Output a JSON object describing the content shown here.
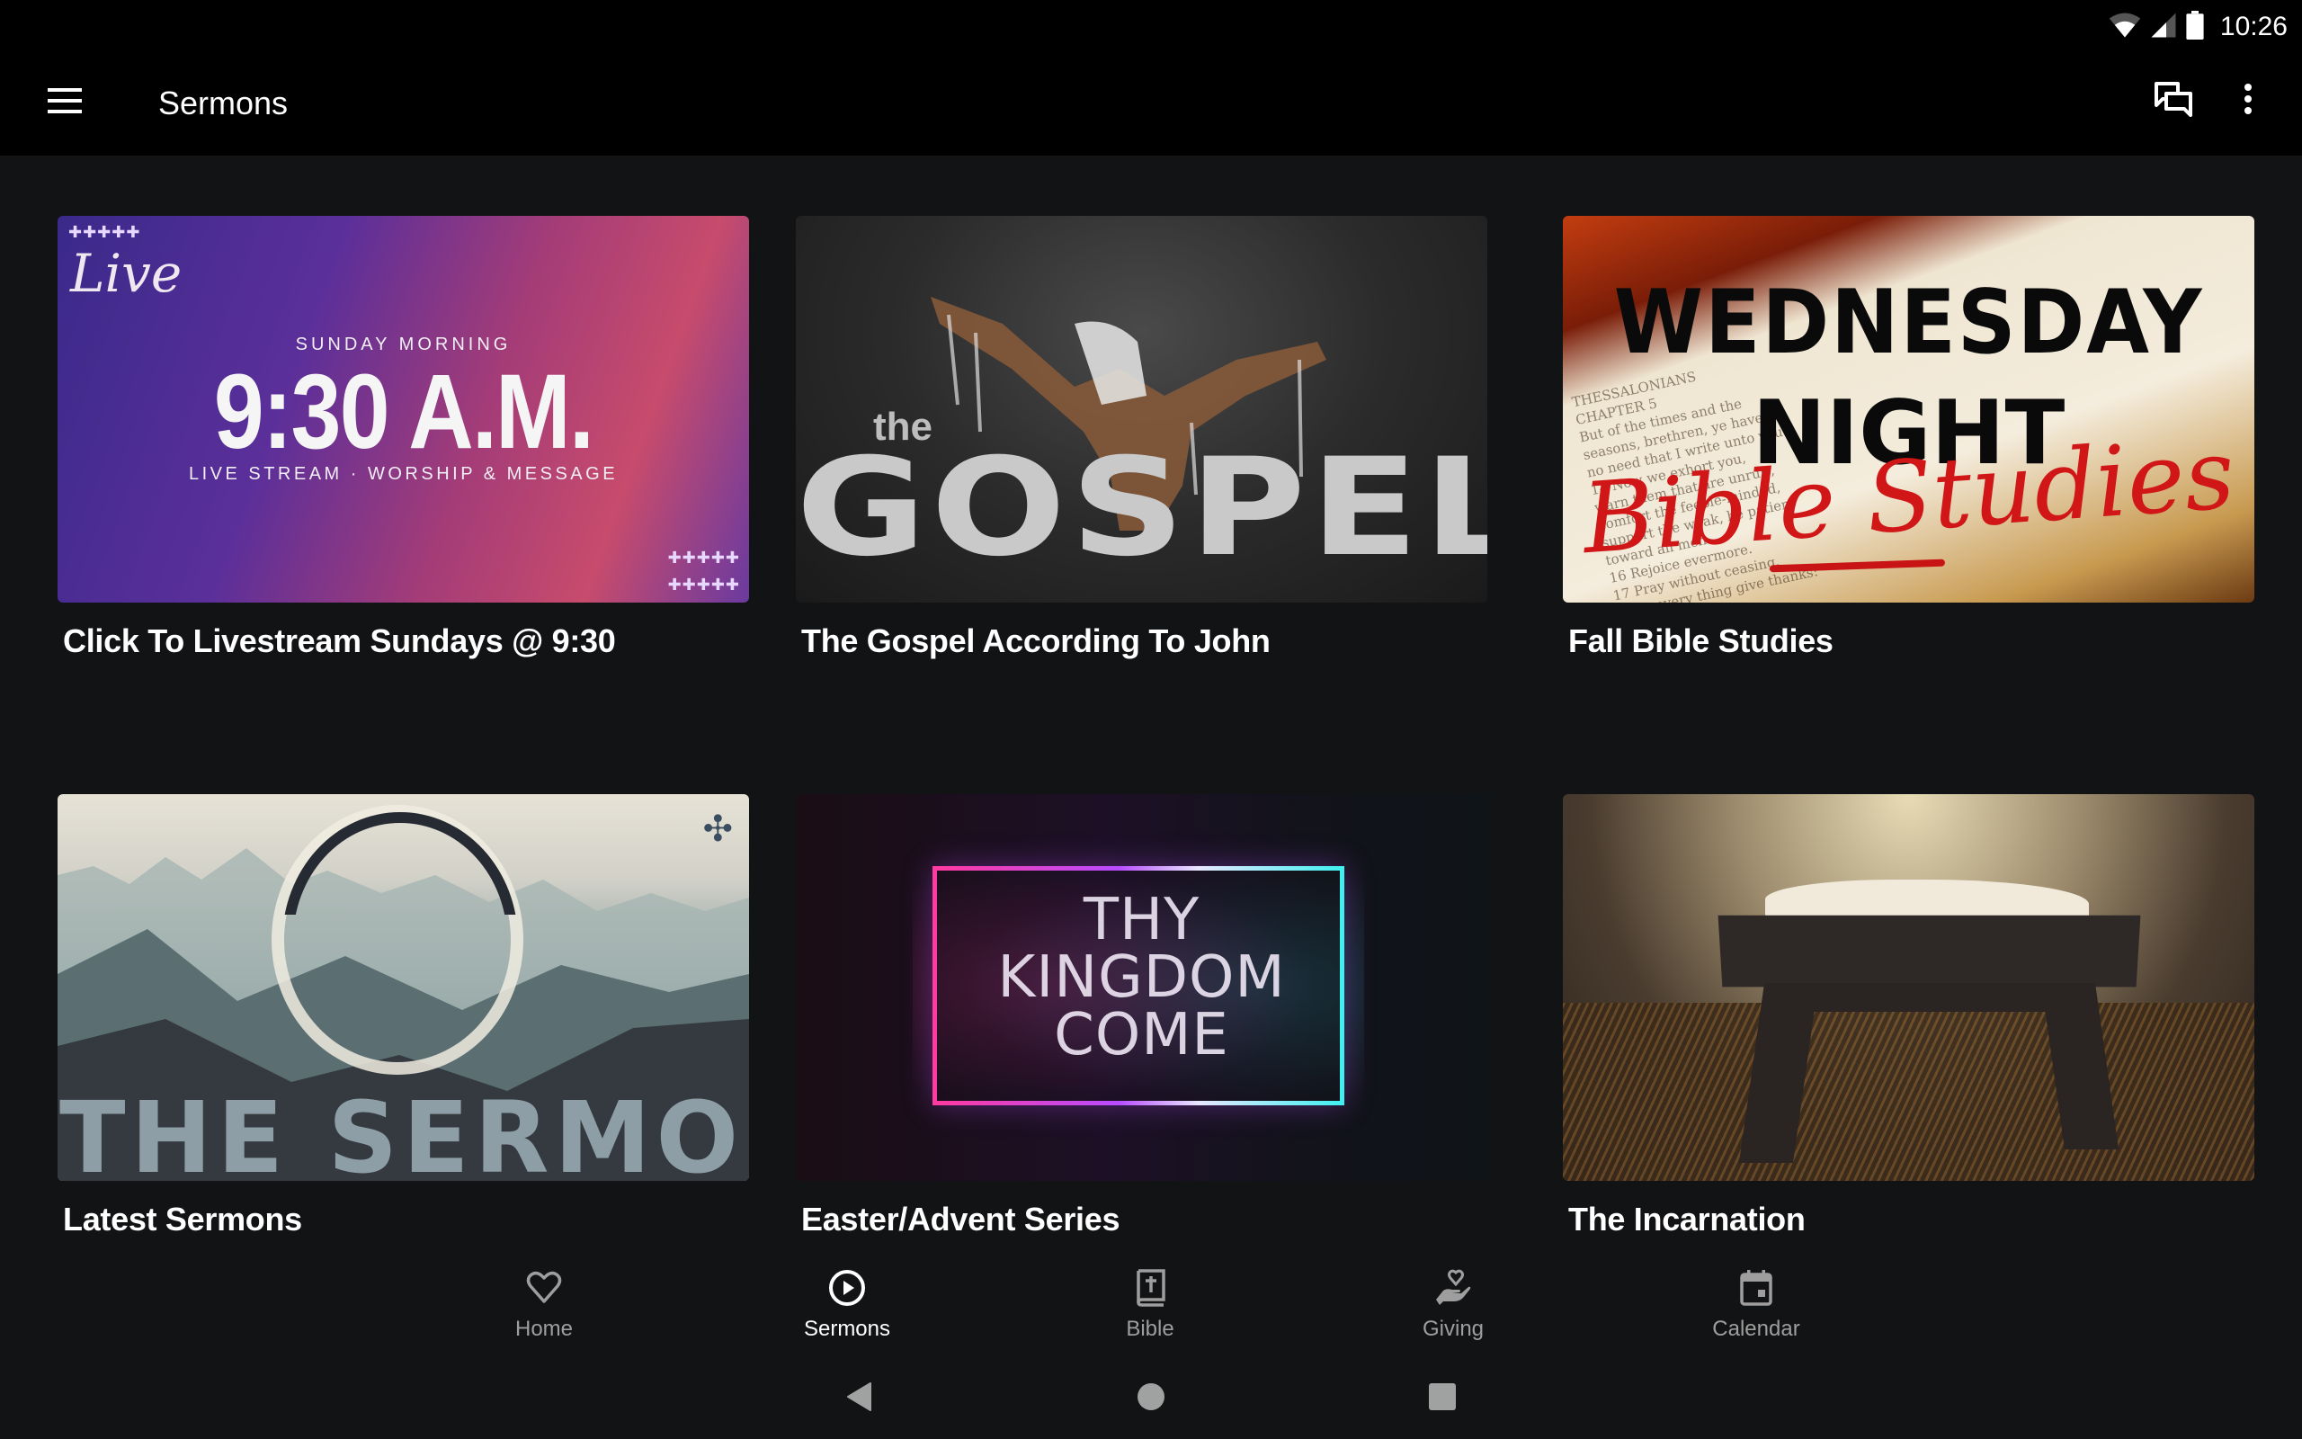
{
  "status_bar": {
    "time": "10:26",
    "icons": [
      "wifi-icon",
      "cellular-signal-icon",
      "battery-icon"
    ]
  },
  "toolbar": {
    "menu_icon": "hamburger-menu-icon",
    "title": "Sermons",
    "actions": [
      "chat-bubbles-icon",
      "more-vert-icon"
    ]
  },
  "colors": {
    "background": "#121315",
    "toolbar": "#000000",
    "active_nav": "#ffffff",
    "inactive_nav": "#9e9e9e"
  },
  "sermon_series": [
    {
      "title": "Click To Livestream Sundays @ 9:30",
      "thumbnail": {
        "badge": "Live",
        "kicker": "SUNDAY MORNING",
        "headline": "9:30 A.M.",
        "tagline": "LIVE STREAM · WORSHIP & MESSAGE",
        "crosses": "✚✚✚✚✚"
      }
    },
    {
      "title": "The Gospel According To John",
      "thumbnail": {
        "small": "the",
        "headline": "GOSPEL"
      }
    },
    {
      "title": "Fall Bible Studies",
      "thumbnail": {
        "line1": "WEDNESDAY",
        "line2": "NIGHT",
        "script": "Bible Studies",
        "page_text": "THESSALONIANS\nCHAPTER 5\nBut of the times and the\nseasons, brethren, ye have\nno need that I write unto you.\n14 Now we exhort you,\nwarn them that are unruly,\ncomfort the feeble-minded,\nsupport the weak, be patient\ntoward all men.\n16 Rejoice evermore.\n17 Pray without ceasing.\n18 In every thing give thanks:"
      }
    },
    {
      "title": "Latest Sermons",
      "thumbnail": {
        "headline": "THE SERMON",
        "logo": "✣"
      }
    },
    {
      "title": "Easter/Advent Series",
      "thumbnail": {
        "line1": "THY",
        "line2": "KINGDOM",
        "line3": "COME"
      }
    },
    {
      "title": "The Incarnation",
      "thumbnail": {}
    }
  ],
  "bottom_nav": [
    {
      "label": "Home",
      "icon": "heart-outline-icon",
      "active": false
    },
    {
      "label": "Sermons",
      "icon": "play-circle-icon",
      "active": true
    },
    {
      "label": "Bible",
      "icon": "bible-icon",
      "active": false
    },
    {
      "label": "Giving",
      "icon": "giving-hand-heart-icon",
      "active": false
    },
    {
      "label": "Calendar",
      "icon": "calendar-icon",
      "active": false
    }
  ],
  "system_nav": [
    "back-icon",
    "home-icon",
    "recents-icon"
  ]
}
